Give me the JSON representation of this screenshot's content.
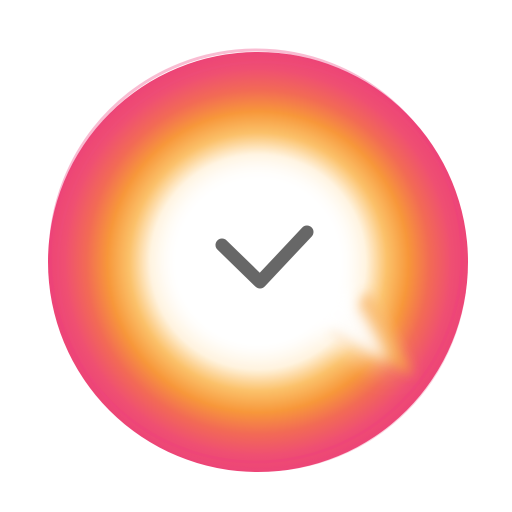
{
  "icon": {
    "name": "chat-check-icon",
    "colors": {
      "background": "#ffffff",
      "outer_pink": "#ee3f7d",
      "mid_orange": "#f59a2e",
      "inner_glow": "#fff7e6",
      "center_white": "#ffffff",
      "check_mark": "#676767"
    }
  }
}
